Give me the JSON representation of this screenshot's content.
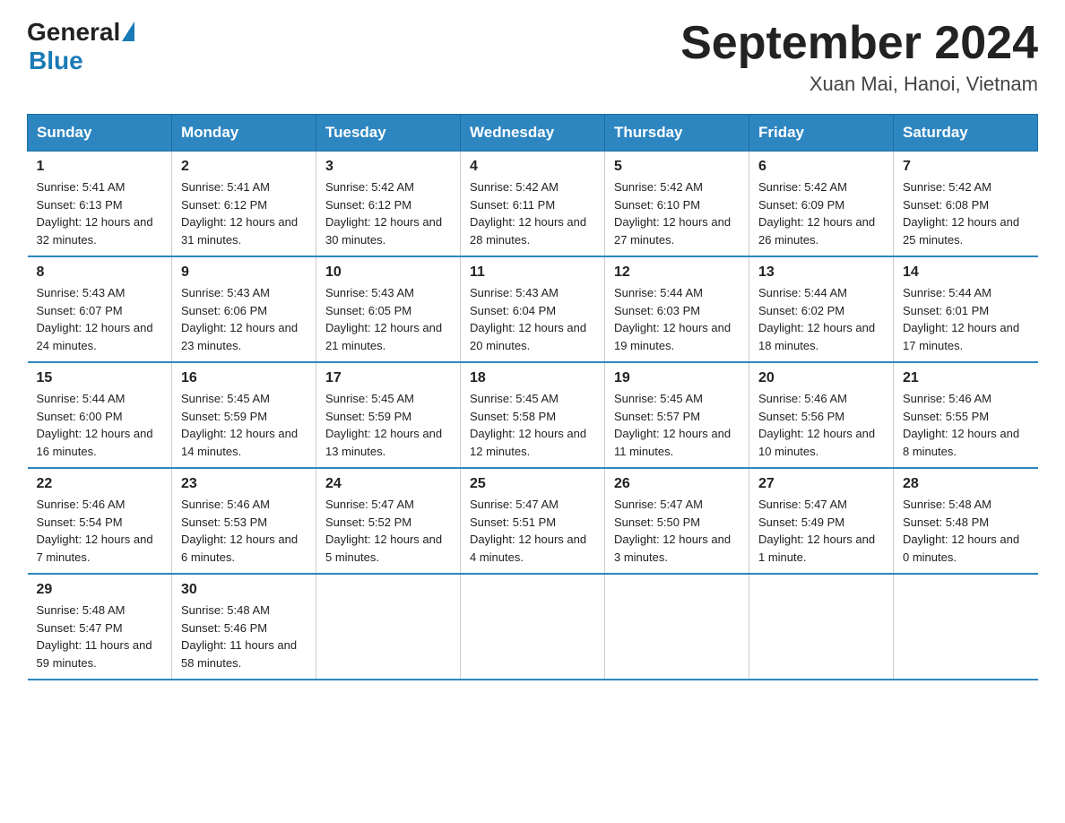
{
  "header": {
    "logo_general": "General",
    "logo_blue": "Blue",
    "month_year": "September 2024",
    "location": "Xuan Mai, Hanoi, Vietnam"
  },
  "days_of_week": [
    "Sunday",
    "Monday",
    "Tuesday",
    "Wednesday",
    "Thursday",
    "Friday",
    "Saturday"
  ],
  "weeks": [
    [
      {
        "day": "1",
        "sunrise": "Sunrise: 5:41 AM",
        "sunset": "Sunset: 6:13 PM",
        "daylight": "Daylight: 12 hours and 32 minutes."
      },
      {
        "day": "2",
        "sunrise": "Sunrise: 5:41 AM",
        "sunset": "Sunset: 6:12 PM",
        "daylight": "Daylight: 12 hours and 31 minutes."
      },
      {
        "day": "3",
        "sunrise": "Sunrise: 5:42 AM",
        "sunset": "Sunset: 6:12 PM",
        "daylight": "Daylight: 12 hours and 30 minutes."
      },
      {
        "day": "4",
        "sunrise": "Sunrise: 5:42 AM",
        "sunset": "Sunset: 6:11 PM",
        "daylight": "Daylight: 12 hours and 28 minutes."
      },
      {
        "day": "5",
        "sunrise": "Sunrise: 5:42 AM",
        "sunset": "Sunset: 6:10 PM",
        "daylight": "Daylight: 12 hours and 27 minutes."
      },
      {
        "day": "6",
        "sunrise": "Sunrise: 5:42 AM",
        "sunset": "Sunset: 6:09 PM",
        "daylight": "Daylight: 12 hours and 26 minutes."
      },
      {
        "day": "7",
        "sunrise": "Sunrise: 5:42 AM",
        "sunset": "Sunset: 6:08 PM",
        "daylight": "Daylight: 12 hours and 25 minutes."
      }
    ],
    [
      {
        "day": "8",
        "sunrise": "Sunrise: 5:43 AM",
        "sunset": "Sunset: 6:07 PM",
        "daylight": "Daylight: 12 hours and 24 minutes."
      },
      {
        "day": "9",
        "sunrise": "Sunrise: 5:43 AM",
        "sunset": "Sunset: 6:06 PM",
        "daylight": "Daylight: 12 hours and 23 minutes."
      },
      {
        "day": "10",
        "sunrise": "Sunrise: 5:43 AM",
        "sunset": "Sunset: 6:05 PM",
        "daylight": "Daylight: 12 hours and 21 minutes."
      },
      {
        "day": "11",
        "sunrise": "Sunrise: 5:43 AM",
        "sunset": "Sunset: 6:04 PM",
        "daylight": "Daylight: 12 hours and 20 minutes."
      },
      {
        "day": "12",
        "sunrise": "Sunrise: 5:44 AM",
        "sunset": "Sunset: 6:03 PM",
        "daylight": "Daylight: 12 hours and 19 minutes."
      },
      {
        "day": "13",
        "sunrise": "Sunrise: 5:44 AM",
        "sunset": "Sunset: 6:02 PM",
        "daylight": "Daylight: 12 hours and 18 minutes."
      },
      {
        "day": "14",
        "sunrise": "Sunrise: 5:44 AM",
        "sunset": "Sunset: 6:01 PM",
        "daylight": "Daylight: 12 hours and 17 minutes."
      }
    ],
    [
      {
        "day": "15",
        "sunrise": "Sunrise: 5:44 AM",
        "sunset": "Sunset: 6:00 PM",
        "daylight": "Daylight: 12 hours and 16 minutes."
      },
      {
        "day": "16",
        "sunrise": "Sunrise: 5:45 AM",
        "sunset": "Sunset: 5:59 PM",
        "daylight": "Daylight: 12 hours and 14 minutes."
      },
      {
        "day": "17",
        "sunrise": "Sunrise: 5:45 AM",
        "sunset": "Sunset: 5:59 PM",
        "daylight": "Daylight: 12 hours and 13 minutes."
      },
      {
        "day": "18",
        "sunrise": "Sunrise: 5:45 AM",
        "sunset": "Sunset: 5:58 PM",
        "daylight": "Daylight: 12 hours and 12 minutes."
      },
      {
        "day": "19",
        "sunrise": "Sunrise: 5:45 AM",
        "sunset": "Sunset: 5:57 PM",
        "daylight": "Daylight: 12 hours and 11 minutes."
      },
      {
        "day": "20",
        "sunrise": "Sunrise: 5:46 AM",
        "sunset": "Sunset: 5:56 PM",
        "daylight": "Daylight: 12 hours and 10 minutes."
      },
      {
        "day": "21",
        "sunrise": "Sunrise: 5:46 AM",
        "sunset": "Sunset: 5:55 PM",
        "daylight": "Daylight: 12 hours and 8 minutes."
      }
    ],
    [
      {
        "day": "22",
        "sunrise": "Sunrise: 5:46 AM",
        "sunset": "Sunset: 5:54 PM",
        "daylight": "Daylight: 12 hours and 7 minutes."
      },
      {
        "day": "23",
        "sunrise": "Sunrise: 5:46 AM",
        "sunset": "Sunset: 5:53 PM",
        "daylight": "Daylight: 12 hours and 6 minutes."
      },
      {
        "day": "24",
        "sunrise": "Sunrise: 5:47 AM",
        "sunset": "Sunset: 5:52 PM",
        "daylight": "Daylight: 12 hours and 5 minutes."
      },
      {
        "day": "25",
        "sunrise": "Sunrise: 5:47 AM",
        "sunset": "Sunset: 5:51 PM",
        "daylight": "Daylight: 12 hours and 4 minutes."
      },
      {
        "day": "26",
        "sunrise": "Sunrise: 5:47 AM",
        "sunset": "Sunset: 5:50 PM",
        "daylight": "Daylight: 12 hours and 3 minutes."
      },
      {
        "day": "27",
        "sunrise": "Sunrise: 5:47 AM",
        "sunset": "Sunset: 5:49 PM",
        "daylight": "Daylight: 12 hours and 1 minute."
      },
      {
        "day": "28",
        "sunrise": "Sunrise: 5:48 AM",
        "sunset": "Sunset: 5:48 PM",
        "daylight": "Daylight: 12 hours and 0 minutes."
      }
    ],
    [
      {
        "day": "29",
        "sunrise": "Sunrise: 5:48 AM",
        "sunset": "Sunset: 5:47 PM",
        "daylight": "Daylight: 11 hours and 59 minutes."
      },
      {
        "day": "30",
        "sunrise": "Sunrise: 5:48 AM",
        "sunset": "Sunset: 5:46 PM",
        "daylight": "Daylight: 11 hours and 58 minutes."
      },
      null,
      null,
      null,
      null,
      null
    ]
  ]
}
